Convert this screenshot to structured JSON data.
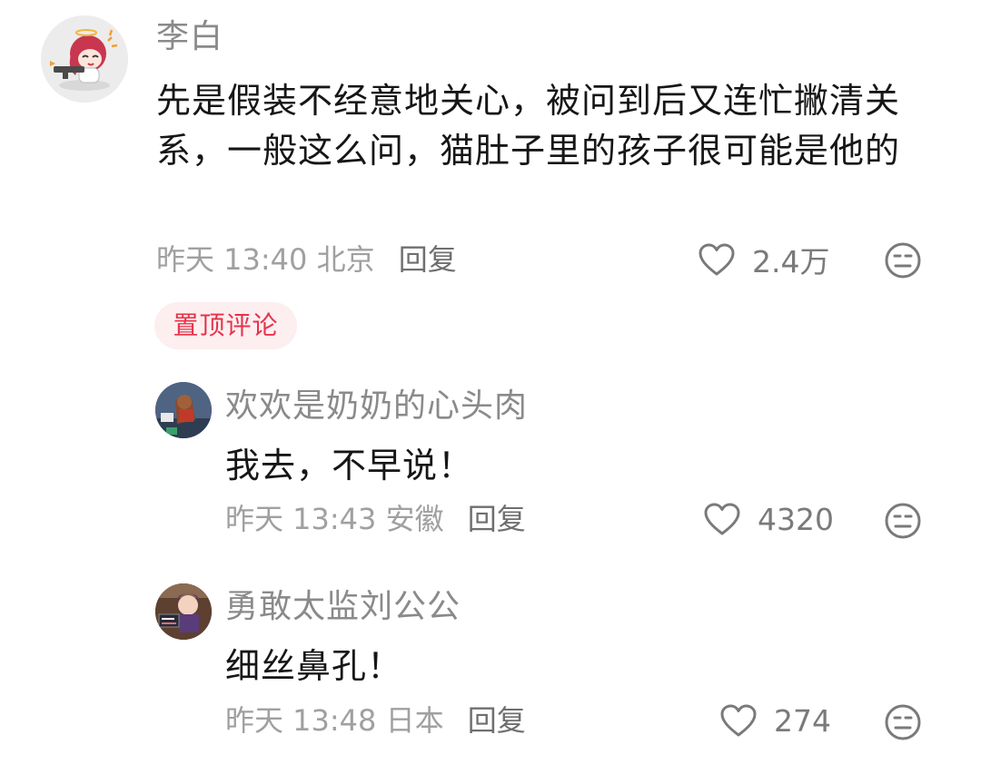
{
  "comment": {
    "user": "李白",
    "text": "先是假装不经意地关心，被问到后又连忙撇清关系，一般这么问，猫肚子里的孩子很可能是他的",
    "time": "昨天 13:40",
    "location": "北京",
    "reply_label": "回复",
    "likes": "2.4万",
    "pin_badge": "置顶评论"
  },
  "replies": [
    {
      "user": "欢欢是奶奶的心头肉",
      "text": "我去，不早说！",
      "time": "昨天 13:43",
      "location": "安徽",
      "reply_label": "回复",
      "likes": "4320"
    },
    {
      "user": "勇敢太监刘公公",
      "text": "细丝鼻孔！",
      "time": "昨天 13:48",
      "location": "日本",
      "reply_label": "回复",
      "likes": "274"
    }
  ],
  "icons": {
    "like": "heart-outline-icon",
    "dislike": "meh-face-icon"
  },
  "colors": {
    "pin_badge_bg": "#fdeef0",
    "pin_badge_text": "#e6334a"
  }
}
